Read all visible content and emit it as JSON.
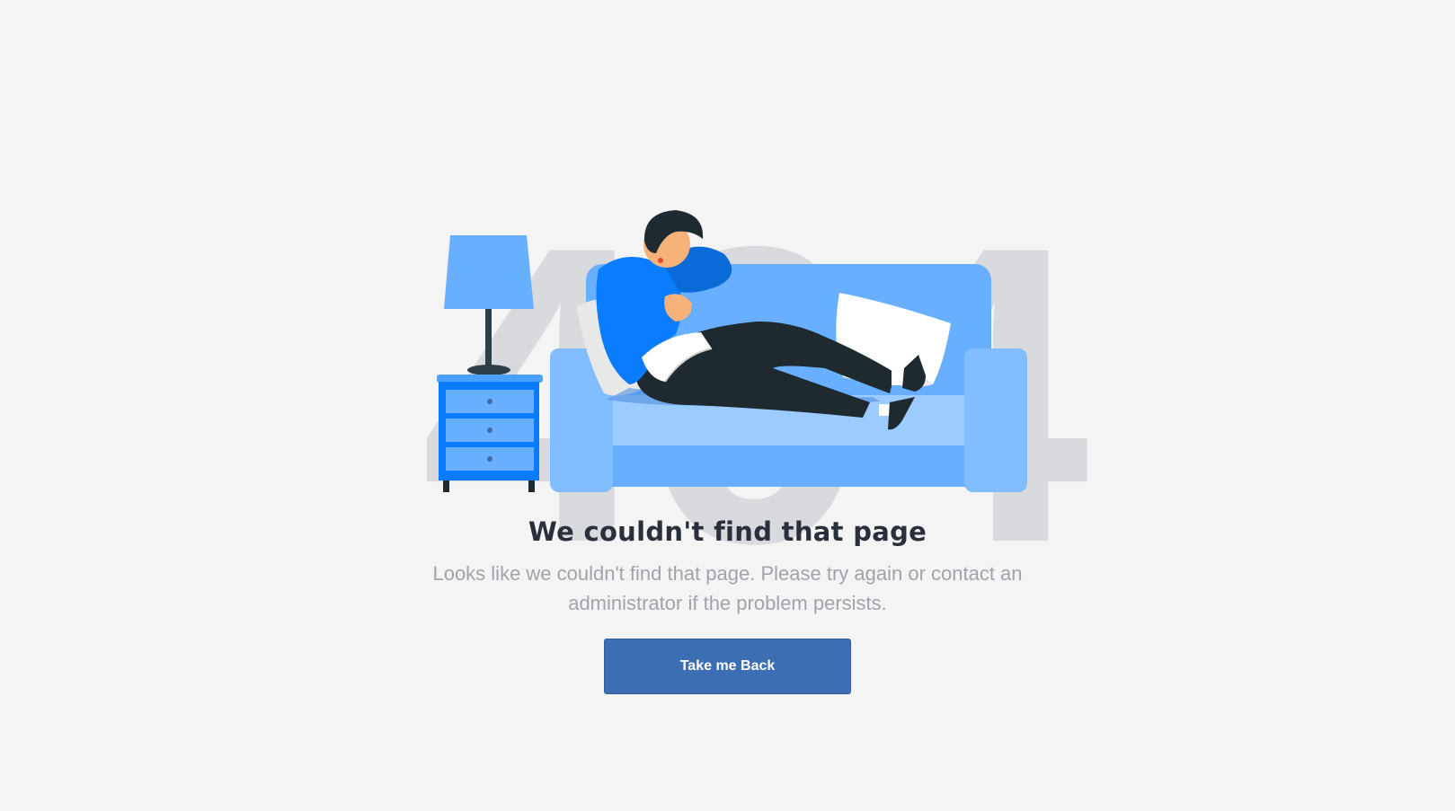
{
  "background_code": "404",
  "error": {
    "title": "We couldn't find that page",
    "description": "Looks like we couldn't find that page. Please try again or contact an administrator if the problem persists."
  },
  "actions": {
    "back_label": "Take me Back"
  },
  "colors": {
    "page_background": "#f4f4f4",
    "code_gray": "#d9dadd",
    "sofa_blue": "#68b0ff",
    "accent_blue": "#0a7cff",
    "button": "#3b6eb2",
    "title": "#2b2f3b",
    "description": "#a0a3ab"
  }
}
